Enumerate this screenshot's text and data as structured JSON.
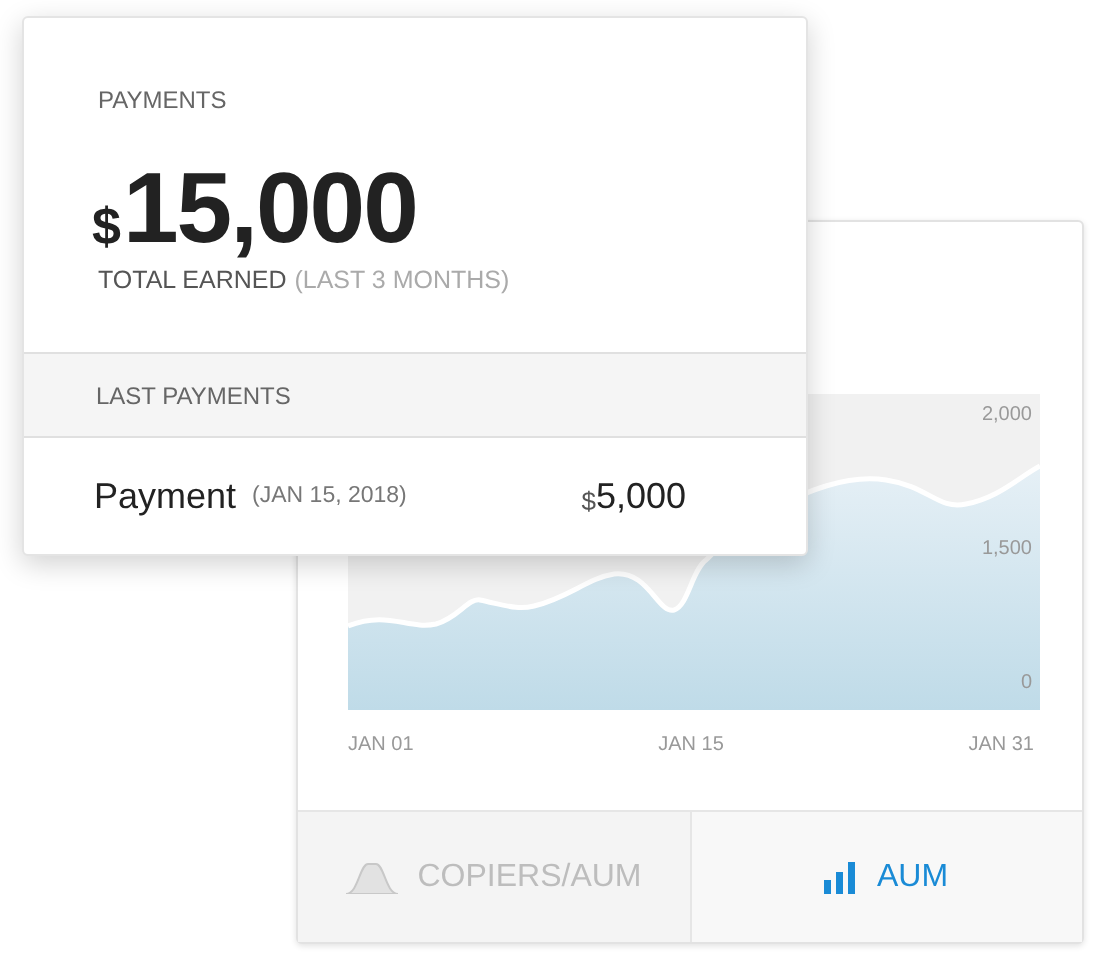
{
  "payments_card": {
    "title": "PAYMENTS",
    "currency": "$",
    "total": "15,000",
    "total_label": "TOTAL EARNED",
    "total_period": "(LAST 3 MONTHS)",
    "section_title": "LAST PAYMENTS",
    "payments": [
      {
        "label": "Payment",
        "date": "(JAN 15, 2018)",
        "currency": "$",
        "amount": "5,000"
      }
    ]
  },
  "chart_card": {
    "y_labels": [
      "2,000",
      "1,500",
      "0"
    ],
    "x_labels": [
      "JAN 01",
      "JAN 15",
      "JAN 31"
    ],
    "tabs": [
      {
        "label": "COPIERS/AUM",
        "kind": "bell",
        "selected": false
      },
      {
        "label": "AUM",
        "kind": "bars",
        "selected": true
      }
    ]
  }
}
